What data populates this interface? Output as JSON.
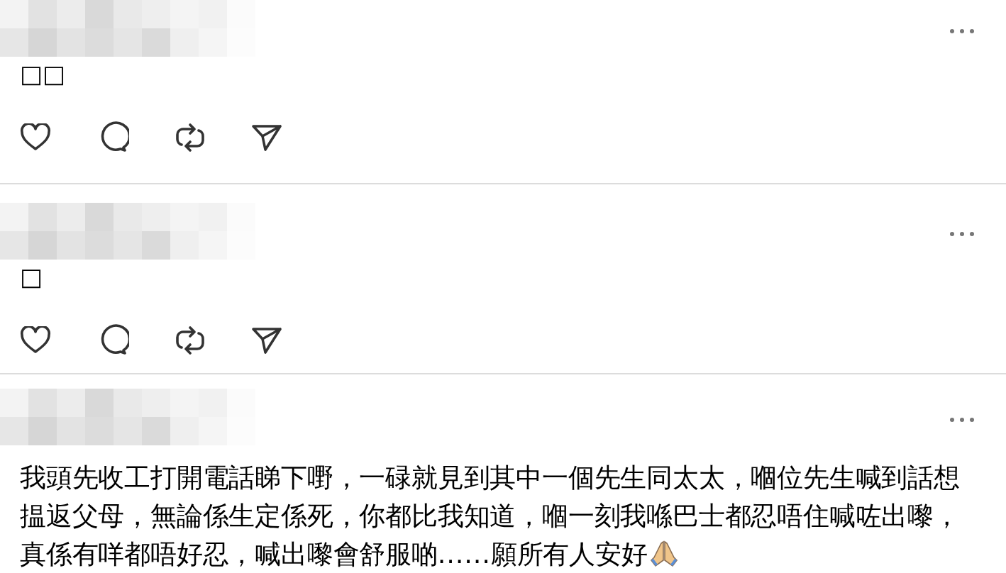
{
  "posts": [
    {
      "text": "□□"
    },
    {
      "text": "□"
    },
    {
      "text": "我頭先收工打開電話睇下嘢，一碌就見到其中一個先生同太太，嗰位先生喊到話想揾返父母，無論係生定係死，你都比我知道，嗰一刻我喺巴士都忍唔住喊咗出嚟，真係有咩都唔好忍，喊出嚟會舒服啲......願所有人安好",
      "praying_hands": true
    }
  ]
}
